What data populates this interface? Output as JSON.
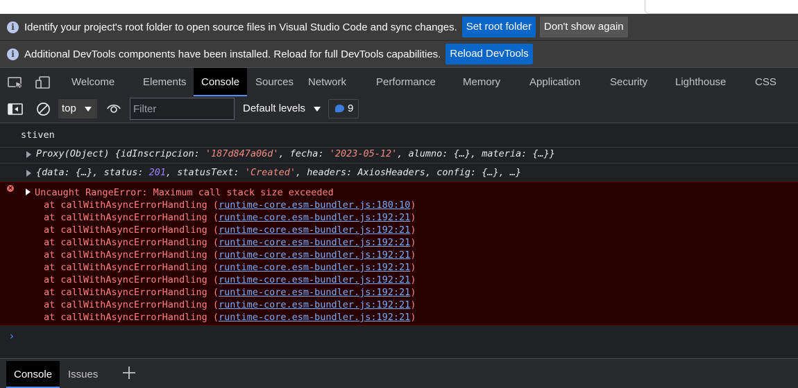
{
  "infobars": [
    {
      "message": "Identify your project's root folder to open source files in Visual Studio Code and sync changes.",
      "primary_button": "Set root folder",
      "secondary_button": "Don't show again"
    },
    {
      "message": "Additional DevTools components have been installed. Reload for full DevTools capabilities.",
      "primary_button": "Reload DevTools"
    }
  ],
  "tabs": [
    "Welcome",
    "Elements",
    "Console",
    "Sources",
    "Network",
    "Performance",
    "Memory",
    "Application",
    "Security",
    "Lighthouse",
    "CSS Over"
  ],
  "active_tab": "Console",
  "toolbar": {
    "context": "top",
    "filter_placeholder": "Filter",
    "levels": "Default levels",
    "issues_count": "9"
  },
  "console": {
    "log_text": "stiven",
    "proxy": {
      "prefix": "Proxy(Object) {",
      "k1": "idInscripcion",
      "v1": "'187d847a06d'",
      "k2": "fecha",
      "v2": "'2023-05-12'",
      "k3": "alumno",
      "v3": "{…}",
      "k4": "materia",
      "v4": "{…}}"
    },
    "response": {
      "k1": "{data",
      "v1": "{…}",
      "k2": "status",
      "v2": "201",
      "k3": "statusText",
      "v3": "'Created'",
      "k4": "headers",
      "v4": "AxiosHeaders",
      "k5": "config",
      "v5": "{…}",
      "tail": ", …}"
    },
    "error": {
      "message": "Uncaught RangeError: Maximum call stack size exceeded",
      "frames": [
        {
          "fn": "at callWithAsyncErrorHandling (",
          "loc": "runtime-core.esm-bundler.js:180:10"
        },
        {
          "fn": "at callWithAsyncErrorHandling (",
          "loc": "runtime-core.esm-bundler.js:192:21"
        },
        {
          "fn": "at callWithAsyncErrorHandling (",
          "loc": "runtime-core.esm-bundler.js:192:21"
        },
        {
          "fn": "at callWithAsyncErrorHandling (",
          "loc": "runtime-core.esm-bundler.js:192:21"
        },
        {
          "fn": "at callWithAsyncErrorHandling (",
          "loc": "runtime-core.esm-bundler.js:192:21"
        },
        {
          "fn": "at callWithAsyncErrorHandling (",
          "loc": "runtime-core.esm-bundler.js:192:21"
        },
        {
          "fn": "at callWithAsyncErrorHandling (",
          "loc": "runtime-core.esm-bundler.js:192:21"
        },
        {
          "fn": "at callWithAsyncErrorHandling (",
          "loc": "runtime-core.esm-bundler.js:192:21"
        },
        {
          "fn": "at callWithAsyncErrorHandling (",
          "loc": "runtime-core.esm-bundler.js:192:21"
        },
        {
          "fn": "at callWithAsyncErrorHandling (",
          "loc": "runtime-core.esm-bundler.js:192:21"
        }
      ]
    },
    "prompt_icon": "chevron-right-icon"
  },
  "drawer": {
    "tabs": [
      "Console",
      "Issues"
    ],
    "add_icon": "plus-icon"
  }
}
